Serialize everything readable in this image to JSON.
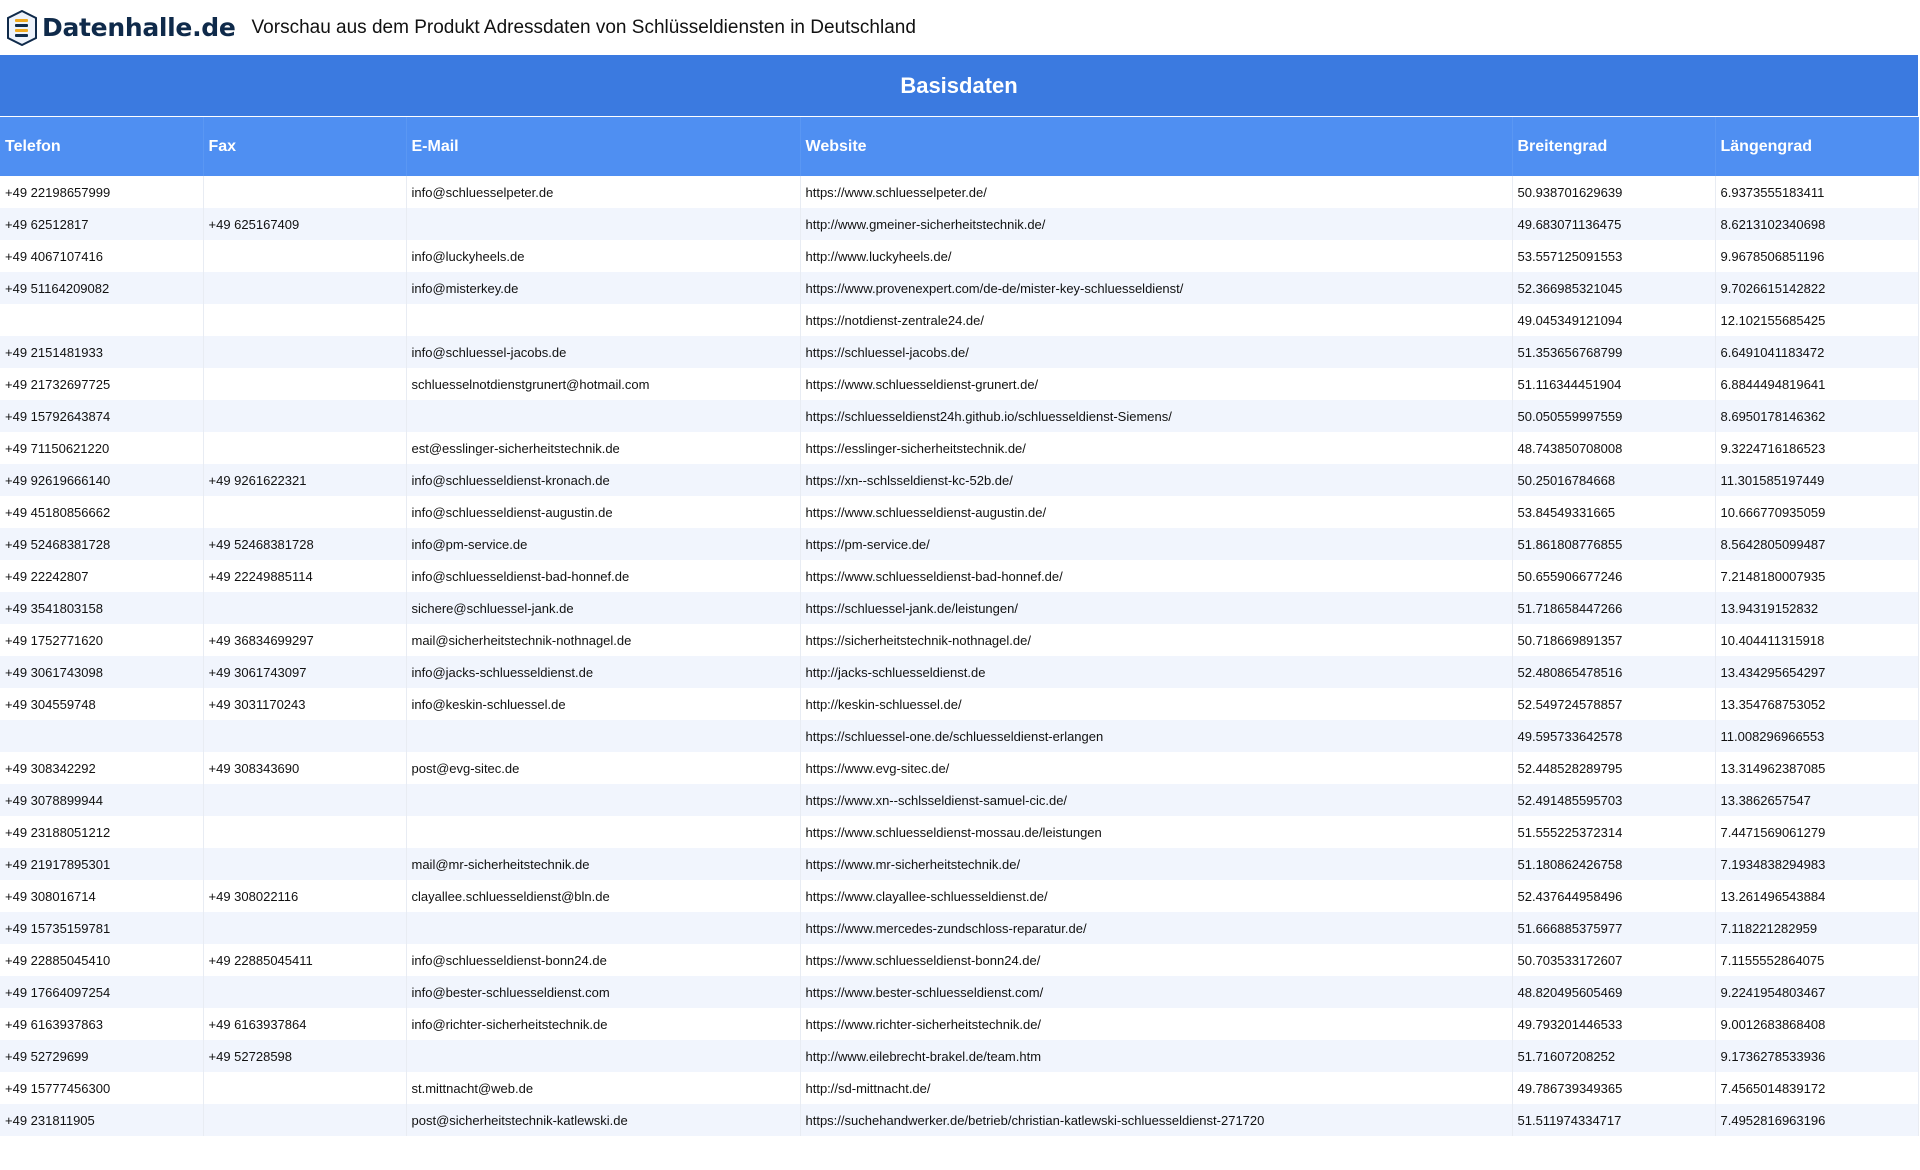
{
  "header": {
    "logo_text": "Datenhalle.de",
    "title": "Vorschau aus dem Produkt Adressdaten von Schlüsseldiensten in Deutschland"
  },
  "table": {
    "group_header": "Basisdaten",
    "columns": [
      "Telefon",
      "Fax",
      "E-Mail",
      "Website",
      "Breitengrad",
      "Längengrad"
    ],
    "rows": [
      [
        "+49 22198657999",
        "",
        "info@schluesselpeter.de",
        "https://www.schluesselpeter.de/",
        "50.938701629639",
        "6.9373555183411"
      ],
      [
        "+49 62512817",
        "+49 625167409",
        "",
        "http://www.gmeiner-sicherheitstechnik.de/",
        "49.683071136475",
        "8.6213102340698"
      ],
      [
        "+49 4067107416",
        "",
        "info@luckyheels.de",
        "http://www.luckyheels.de/",
        "53.557125091553",
        "9.9678506851196"
      ],
      [
        "+49 51164209082",
        "",
        "info@misterkey.de",
        "https://www.provenexpert.com/de-de/mister-key-schluesseldienst/",
        "52.366985321045",
        "9.7026615142822"
      ],
      [
        "",
        "",
        "",
        "https://notdienst-zentrale24.de/",
        "49.045349121094",
        "12.102155685425"
      ],
      [
        "+49 2151481933",
        "",
        "info@schluessel-jacobs.de",
        "https://schluessel-jacobs.de/",
        "51.353656768799",
        "6.6491041183472"
      ],
      [
        "+49 21732697725",
        "",
        "schluesselnotdienstgrunert@hotmail.com",
        "https://www.schluesseldienst-grunert.de/",
        "51.116344451904",
        "6.8844494819641"
      ],
      [
        "+49 15792643874",
        "",
        "",
        "https://schluesseldienst24h.github.io/schluesseldienst-Siemens/",
        "50.050559997559",
        "8.6950178146362"
      ],
      [
        "+49 71150621220",
        "",
        "est@esslinger-sicherheitstechnik.de",
        "https://esslinger-sicherheitstechnik.de/",
        "48.743850708008",
        "9.3224716186523"
      ],
      [
        "+49 92619666140",
        "+49 9261622321",
        "info@schluesseldienst-kronach.de",
        "https://xn--schlsseldienst-kc-52b.de/",
        "50.25016784668",
        "11.301585197449"
      ],
      [
        "+49 45180856662",
        "",
        "info@schluesseldienst-augustin.de",
        "https://www.schluesseldienst-augustin.de/",
        "53.84549331665",
        "10.666770935059"
      ],
      [
        "+49 52468381728",
        "+49 52468381728",
        "info@pm-service.de",
        "https://pm-service.de/",
        "51.861808776855",
        "8.5642805099487"
      ],
      [
        "+49 22242807",
        "+49 22249885114",
        "info@schluesseldienst-bad-honnef.de",
        "https://www.schluesseldienst-bad-honnef.de/",
        "50.655906677246",
        "7.2148180007935"
      ],
      [
        "+49 3541803158",
        "",
        "sichere@schluessel-jank.de",
        "https://schluessel-jank.de/leistungen/",
        "51.718658447266",
        "13.94319152832"
      ],
      [
        "+49 1752771620",
        "+49 36834699297",
        "mail@sicherheitstechnik-nothnagel.de",
        "https://sicherheitstechnik-nothnagel.de/",
        "50.718669891357",
        "10.404411315918"
      ],
      [
        "+49 3061743098",
        "+49 3061743097",
        "info@jacks-schluesseldienst.de",
        "http://jacks-schluesseldienst.de",
        "52.480865478516",
        "13.434295654297"
      ],
      [
        "+49 304559748",
        "+49 3031170243",
        "info@keskin-schluessel.de",
        "http://keskin-schluessel.de/",
        "52.549724578857",
        "13.354768753052"
      ],
      [
        "",
        "",
        "",
        "https://schluessel-one.de/schluesseldienst-erlangen",
        "49.595733642578",
        "11.008296966553"
      ],
      [
        "+49 308342292",
        "+49 308343690",
        "post@evg-sitec.de",
        "https://www.evg-sitec.de/",
        "52.448528289795",
        "13.314962387085"
      ],
      [
        "+49 3078899944",
        "",
        "",
        "https://www.xn--schlsseldienst-samuel-cic.de/",
        "52.491485595703",
        "13.3862657547"
      ],
      [
        "+49 23188051212",
        "",
        "",
        "https://www.schluesseldienst-mossau.de/leistungen",
        "51.555225372314",
        "7.4471569061279"
      ],
      [
        "+49 21917895301",
        "",
        "mail@mr-sicherheitstechnik.de",
        "https://www.mr-sicherheitstechnik.de/",
        "51.180862426758",
        "7.1934838294983"
      ],
      [
        "+49 308016714",
        "+49 308022116",
        "clayallee.schluesseldienst@bln.de",
        "https://www.clayallee-schluesseldienst.de/",
        "52.437644958496",
        "13.261496543884"
      ],
      [
        "+49 15735159781",
        "",
        "",
        "https://www.mercedes-zundschloss-reparatur.de/",
        "51.666885375977",
        "7.118221282959"
      ],
      [
        "+49 22885045410",
        "+49 22885045411",
        "info@schluesseldienst-bonn24.de",
        "https://www.schluesseldienst-bonn24.de/",
        "50.703533172607",
        "7.1155552864075"
      ],
      [
        "+49 17664097254",
        "",
        "info@bester-schluesseldienst.com",
        "https://www.bester-schluesseldienst.com/",
        "48.820495605469",
        "9.2241954803467"
      ],
      [
        "+49 6163937863",
        "+49 6163937864",
        "info@richter-sicherheitstechnik.de",
        "https://www.richter-sicherheitstechnik.de/",
        "49.793201446533",
        "9.0012683868408"
      ],
      [
        "+49 52729699",
        "+49 52728598",
        "",
        "http://www.eilebrecht-brakel.de/team.htm",
        "51.71607208252",
        "9.1736278533936"
      ],
      [
        "+49 15777456300",
        "",
        "st.mittnacht@web.de",
        "http://sd-mittnacht.de/",
        "49.786739349365",
        "7.4565014839172"
      ],
      [
        "+49 231811905",
        "",
        "post@sicherheitstechnik-katlewski.de",
        "https://suchehandwerker.de/betrieb/christian-katlewski-schluesseldienst-271720",
        "51.511974334717",
        "7.4952816963196"
      ]
    ]
  }
}
